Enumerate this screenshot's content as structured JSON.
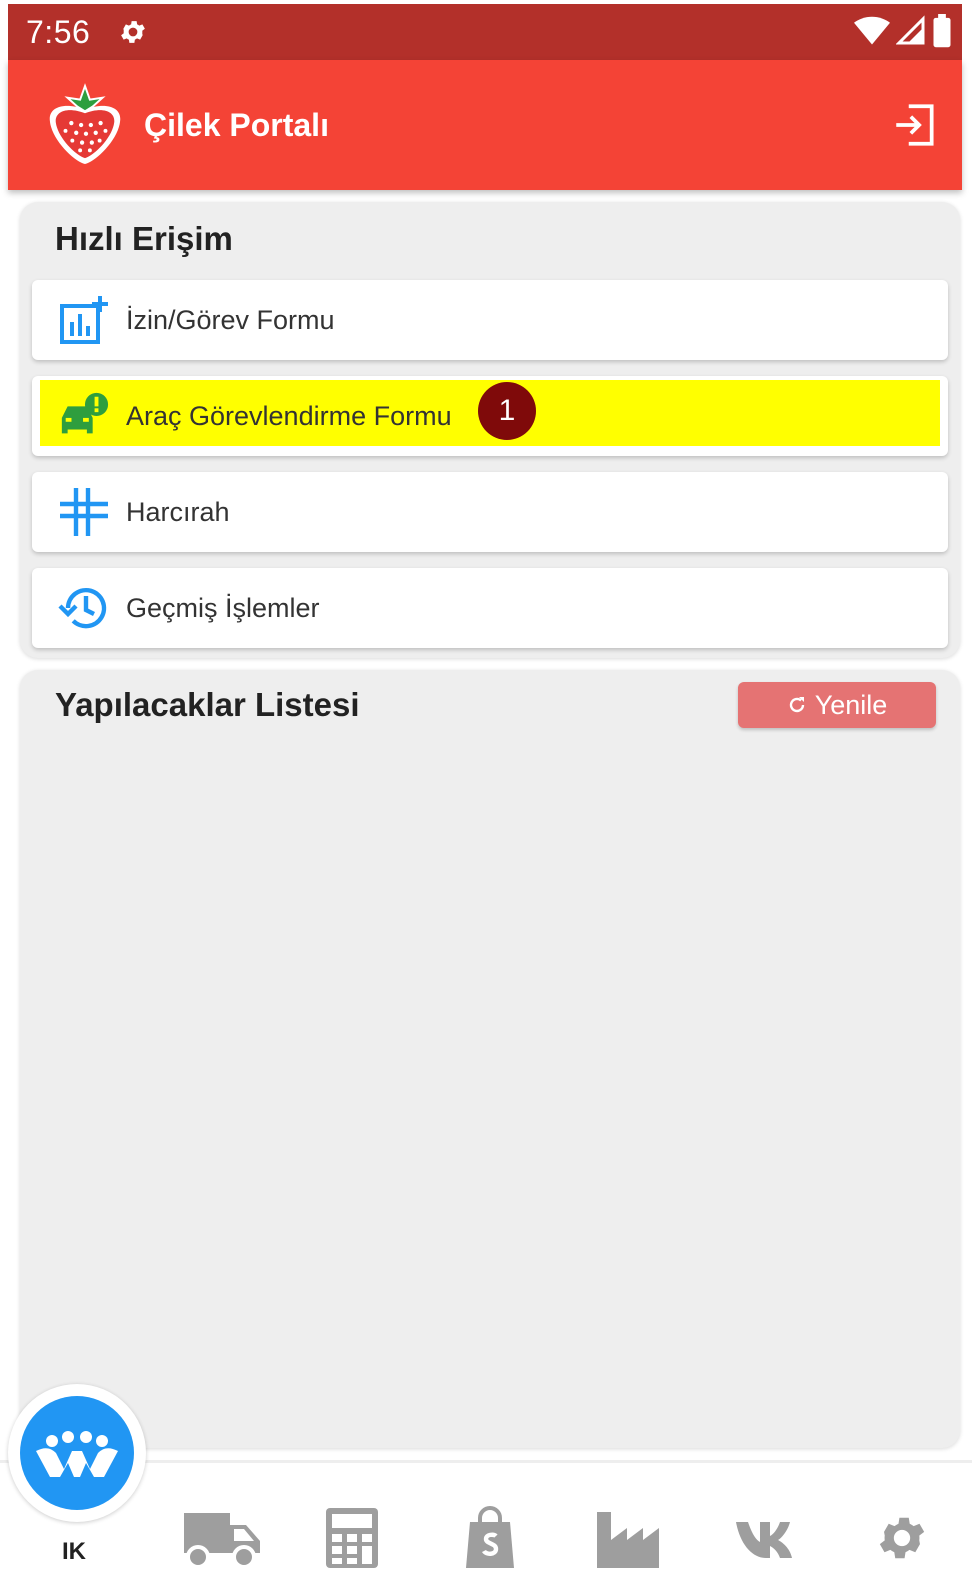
{
  "status_bar": {
    "time": "7:56"
  },
  "app_bar": {
    "title": "Çilek Portalı"
  },
  "quick_access": {
    "title": "Hızlı Erişim",
    "items": [
      {
        "label": "İzin/Görev Formu",
        "icon": "chart-add-icon"
      },
      {
        "label": "Araç Görevlendirme Formu",
        "icon": "car-alert-icon",
        "badge": "1",
        "highlight_color": "#ffff00"
      },
      {
        "label": "Harcırah",
        "icon": "grid-lines-icon"
      },
      {
        "label": "Geçmiş İşlemler",
        "icon": "history-icon"
      }
    ]
  },
  "todo": {
    "title": "Yapılacaklar Listesi",
    "refresh_label": "Yenile"
  },
  "bottom_nav": {
    "active_label": "IK",
    "items": [
      "hr-people-icon",
      "truck-icon",
      "calculator-icon",
      "shopify-bag-icon",
      "factory-icon",
      "vk-icon",
      "gear-icon"
    ]
  },
  "colors": {
    "status_bar": "#b3302a",
    "app_bar": "#f44336",
    "accent_blue": "#2196f3",
    "badge": "#7f0a0a",
    "refresh_button": "#e57373",
    "nav_icon": "#9e9e9e",
    "car_icon": "#2e9e3e"
  }
}
